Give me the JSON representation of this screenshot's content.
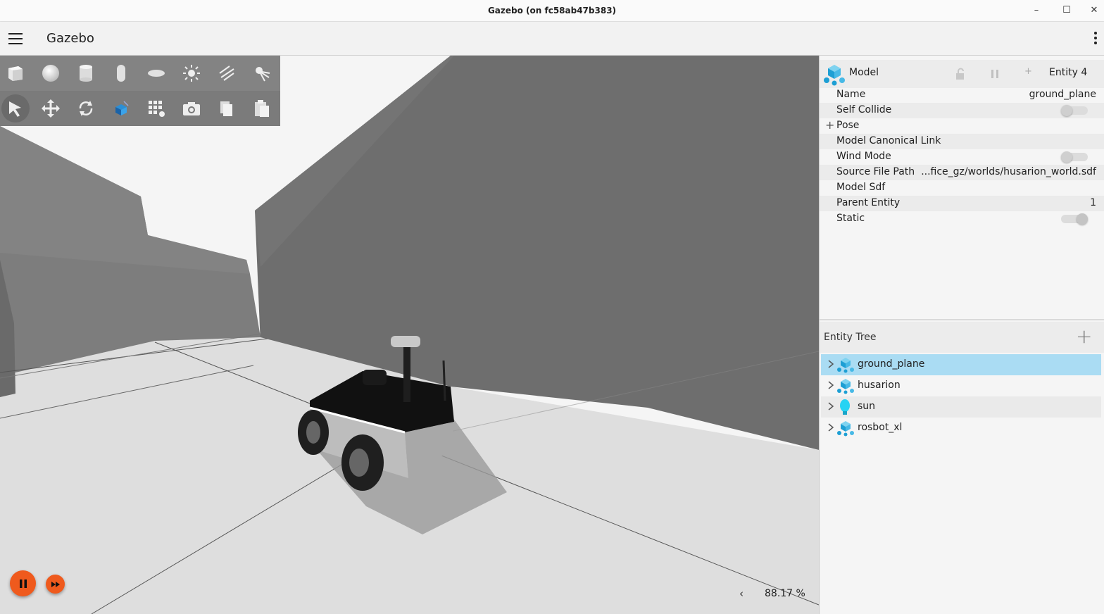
{
  "window": {
    "title": "Gazebo (on fc58ab47b383)",
    "minimize": "–",
    "maximize": "☐",
    "close": "✕"
  },
  "header": {
    "title": "Gazebo"
  },
  "toolbar": {
    "shapes": [
      "box-icon",
      "sphere-icon",
      "cylinder-icon",
      "capsule-icon",
      "ellipsoid-icon",
      "point-light-icon",
      "directional-light-icon",
      "spot-light-icon"
    ],
    "tools": [
      "select-icon",
      "translate-icon",
      "rotate-icon",
      "transform-control-icon",
      "grid-snap-icon",
      "screenshot-icon",
      "copy-icon",
      "paste-icon"
    ]
  },
  "playback": {
    "state": "playing",
    "rtf_value": "88.17 %",
    "rtf_toggle": "‹"
  },
  "component_inspector": {
    "type": "Model",
    "entity": "Entity 4",
    "add_label": "+",
    "properties": [
      {
        "label": "Name",
        "value": "ground_plane",
        "kind": "text"
      },
      {
        "label": "Self Collide",
        "value": "",
        "kind": "toggle",
        "on": false
      },
      {
        "label": "Pose",
        "value": "",
        "kind": "expand"
      },
      {
        "label": "Model Canonical Link",
        "value": "",
        "kind": "text"
      },
      {
        "label": "Wind Mode",
        "value": "",
        "kind": "toggle",
        "on": false
      },
      {
        "label": "Source File Path",
        "value": "...fice_gz/worlds/husarion_world.sdf",
        "kind": "text"
      },
      {
        "label": "Model Sdf",
        "value": "",
        "kind": "text"
      },
      {
        "label": "Parent Entity",
        "value": "1",
        "kind": "text"
      },
      {
        "label": "Static",
        "value": "",
        "kind": "toggle",
        "on": true
      }
    ]
  },
  "entity_tree": {
    "title": "Entity Tree",
    "add_label": "+",
    "items": [
      {
        "label": "ground_plane",
        "icon": "model-icon",
        "selected": true
      },
      {
        "label": "husarion",
        "icon": "model-icon",
        "selected": false
      },
      {
        "label": "sun",
        "icon": "light-bulb-icon",
        "selected": false
      },
      {
        "label": "rosbot_xl",
        "icon": "model-icon",
        "selected": false
      }
    ]
  },
  "colors": {
    "accent": "#ef5a1d",
    "selection": "#aadcf3",
    "model_icon": "#29b6e6"
  }
}
